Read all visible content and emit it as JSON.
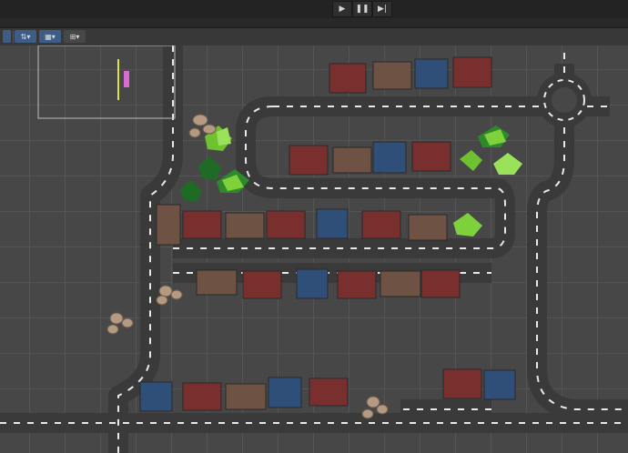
{
  "playbar": {
    "play_icon": "▶",
    "pause_icon": "❚❚",
    "step_icon": "▶|"
  },
  "toolbar": {
    "buttons": [
      {
        "name": "gizmo-toggle",
        "icon": "⇅"
      },
      {
        "name": "grid-snap",
        "icon": "▦"
      },
      {
        "name": "ruler-tool",
        "icon": "⊞"
      }
    ]
  },
  "scene": {
    "grid_color": "#555555",
    "road_color": "#3a3a3a",
    "colors": {
      "roof_red": "#7a2f2f",
      "roof_blue": "#2f4f78",
      "roof_brown": "#6e5243",
      "bush_green": "#7fd13b",
      "tree_dark": "#1f6a24",
      "rock": "#b49a82",
      "camera_gizmo": "#e0e040",
      "camera_label": "#d96bd1"
    }
  }
}
